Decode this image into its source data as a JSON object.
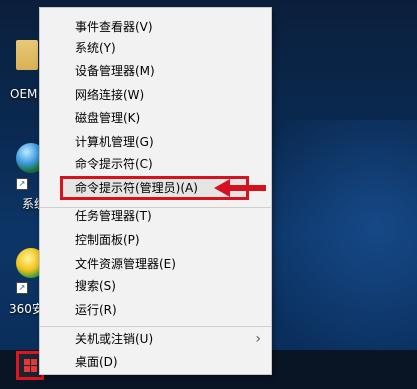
{
  "desktop": {
    "icons": [
      {
        "name": "oem-folder",
        "label": "OEM"
      },
      {
        "name": "system-globe",
        "label": "系统"
      },
      {
        "name": "360-browser",
        "label": "360安"
      }
    ]
  },
  "context_menu": {
    "items": [
      {
        "label": "事件查看器(V)"
      },
      {
        "label": "系统(Y)"
      },
      {
        "label": "设备管理器(M)"
      },
      {
        "label": "网络连接(W)"
      },
      {
        "label": "磁盘管理(K)"
      },
      {
        "label": "计算机管理(G)"
      },
      {
        "label": "命令提示符(C)"
      },
      {
        "label": "命令提示符(管理员)(A)",
        "highlighted": true
      },
      {
        "label": "任务管理器(T)"
      },
      {
        "label": "控制面板(P)"
      },
      {
        "label": "文件资源管理器(E)"
      },
      {
        "label": "搜索(S)"
      },
      {
        "label": "运行(R)"
      },
      {
        "label": "关机或注销(U)",
        "has_submenu": true,
        "submenu_glyph": "›"
      },
      {
        "label": "桌面(D)"
      }
    ]
  },
  "annotation": {
    "color": "#d6121e"
  },
  "taskbar": {
    "start_icon": "windows-logo-icon"
  }
}
